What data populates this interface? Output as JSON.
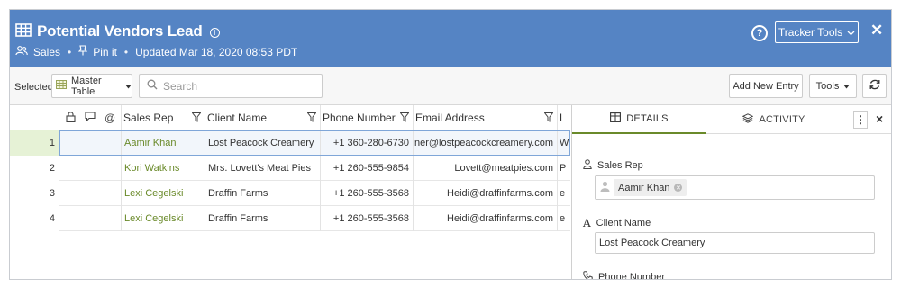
{
  "header": {
    "title": "Potential Vendors Lead",
    "workspace": "Sales",
    "pin_label": "Pin it",
    "updated": "Updated Mar 18, 2020 08:53 PDT",
    "tracker_tools_label": "Tracker Tools",
    "help_glyph": "?",
    "close_glyph": "✕"
  },
  "toolbar": {
    "selected_label": "Selected:",
    "view_value": "Master Table",
    "search_placeholder": "Search",
    "add_new_label": "Add New Entry",
    "tools_label": "Tools"
  },
  "table": {
    "columns": [
      "Sales Rep",
      "Client Name",
      "Phone Number",
      "Email Address",
      "L"
    ],
    "rows": [
      {
        "num": "1",
        "rep": "Aamir Khan",
        "client": "Lost Peacock Creamery",
        "phone": "+1 360-280-6730",
        "email": "Owner@lostpeacockcreamery.com",
        "extra": "W"
      },
      {
        "num": "2",
        "rep": "Kori Watkins",
        "client": "Mrs. Lovett's Meat Pies",
        "phone": "+1 260-555-9854",
        "email": "Lovett@meatpies.com",
        "extra": "P"
      },
      {
        "num": "3",
        "rep": "Lexi Cegelski",
        "client": "Draffin Farms",
        "phone": "+1 260-555-3568",
        "email": "Heidi@draffinfarms.com",
        "extra": "e"
      },
      {
        "num": "4",
        "rep": "Lexi Cegelski",
        "client": "Draffin Farms",
        "phone": "+1 260-555-3568",
        "email": "Heidi@draffinfarms.com",
        "extra": "e"
      }
    ],
    "accent_color": "#6a8a2a"
  },
  "panel": {
    "tab_details": "DETAILS",
    "tab_activity": "ACTIVITY",
    "fields": {
      "sales_rep_label": "Sales Rep",
      "sales_rep_value": "Aamir Khan",
      "client_label": "Client Name",
      "client_value": "Lost Peacock Creamery",
      "phone_label": "Phone Number"
    }
  },
  "colors": {
    "header_bg": "#5584c4",
    "active_tab": "#6a8a2a"
  }
}
